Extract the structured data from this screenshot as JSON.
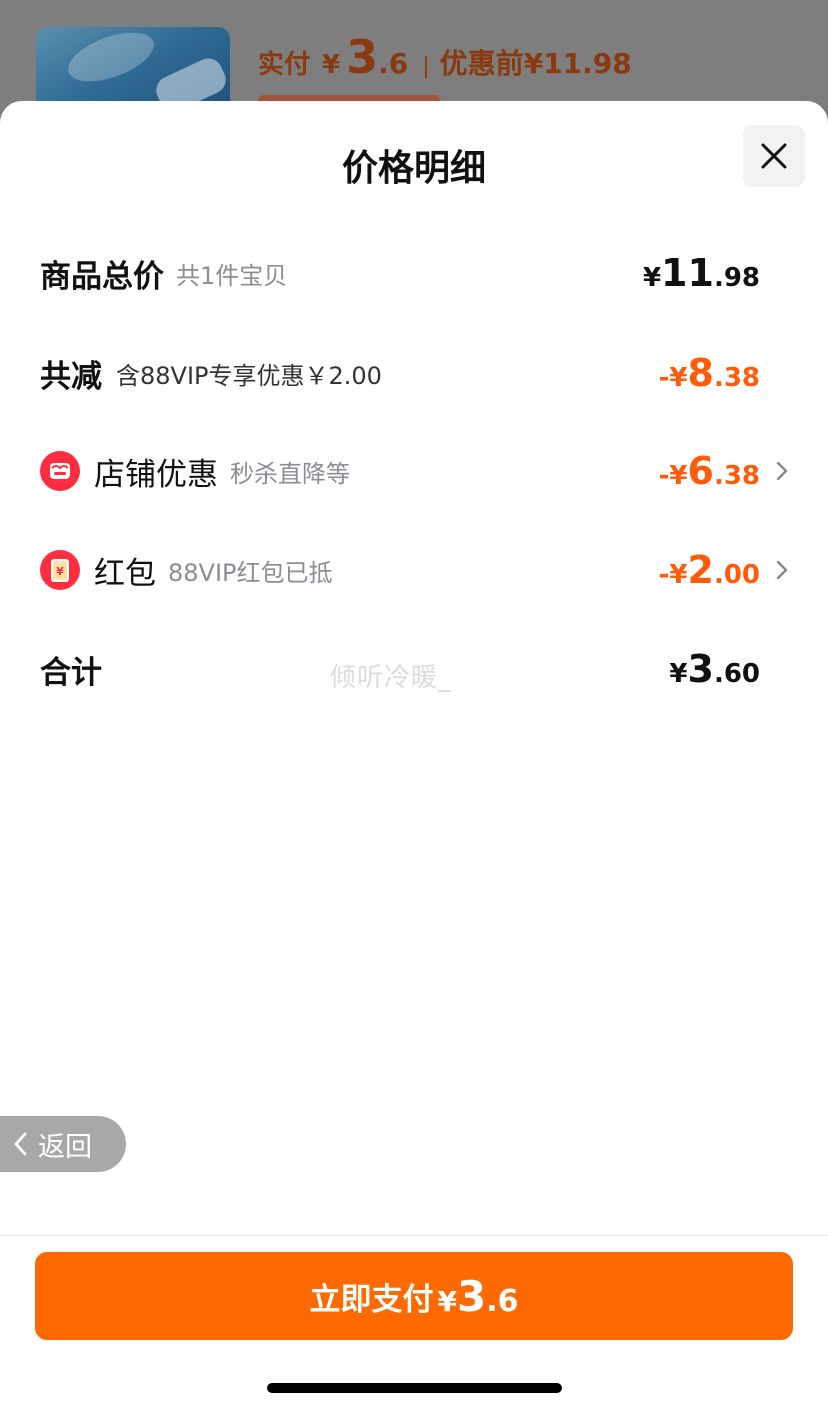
{
  "background": {
    "paid_label": "实付",
    "currency": "¥",
    "paid_int": "3",
    "paid_dec": ".6",
    "separator": "|",
    "original_label": "优惠前",
    "original_price": "¥11.98"
  },
  "sheet": {
    "title": "价格明细",
    "close_icon": "close-icon"
  },
  "rows": {
    "total": {
      "label": "商品总价",
      "sub": "共1件宝贝",
      "yen": "¥",
      "int": "11",
      "dec": ".98"
    },
    "discount": {
      "label": "共减",
      "sub": "含88VIP专享优惠￥2.00",
      "yen": "-¥",
      "int": "8",
      "dec": ".38"
    },
    "shop": {
      "icon": "shop-icon",
      "label": "店铺优惠",
      "sub": "秒杀直降等",
      "yen": "-¥",
      "int": "6",
      "dec": ".38"
    },
    "redpacket": {
      "icon": "red-packet-icon",
      "label": "红包",
      "sub": "88VIP红包已抵",
      "yen": "-¥",
      "int": "2",
      "dec": ".00"
    },
    "sum": {
      "label": "合计",
      "yen": "¥",
      "int": "3",
      "dec": ".60"
    }
  },
  "watermark": "倾听冷暖_",
  "back": {
    "label": "返回",
    "icon": "chevron-left-icon"
  },
  "pay_button": {
    "label": "立即支付",
    "yen": "¥",
    "int": "3",
    "dec": ".6"
  },
  "colors": {
    "accent": "#ff6a00",
    "discount": "#ff5b0a",
    "text": "#111111",
    "muted": "#8c8c94"
  }
}
